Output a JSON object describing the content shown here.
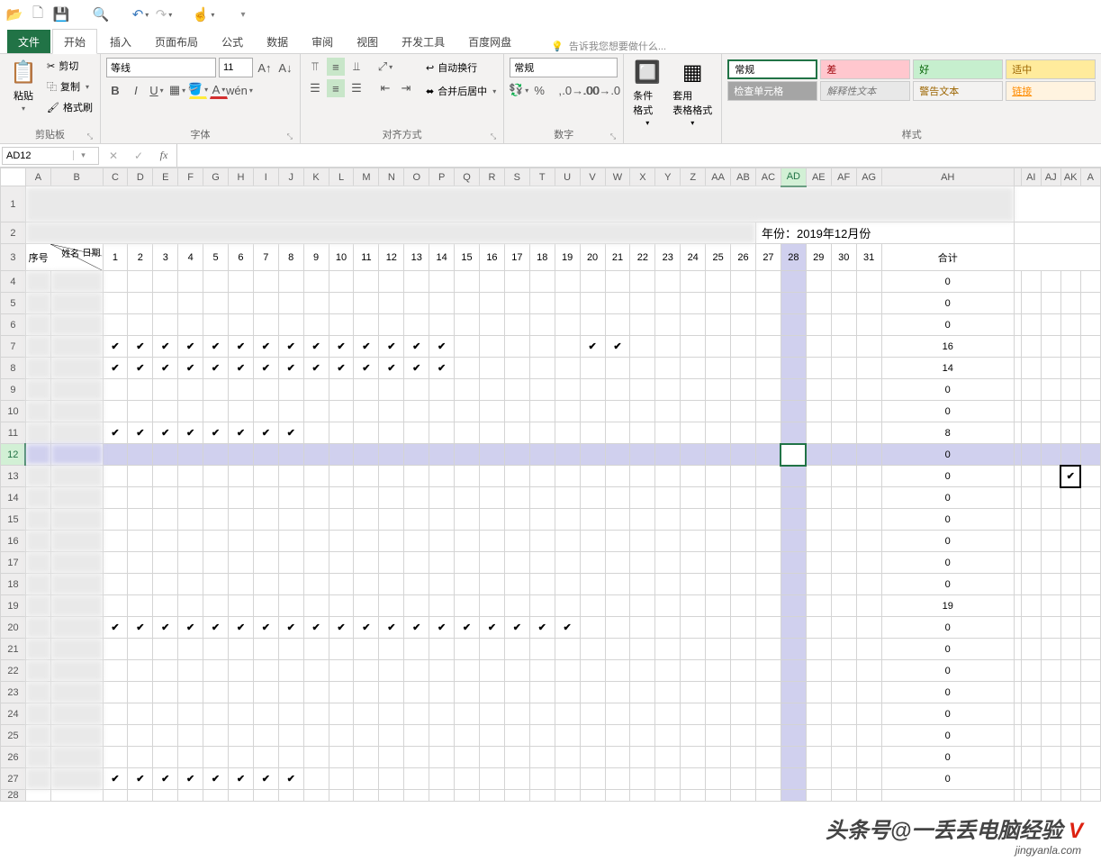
{
  "qat_icons": [
    "folder-open",
    "new-file",
    "save",
    "separator",
    "page-view",
    "separator",
    "undo",
    "redo",
    "separator",
    "touch-mode",
    "separator",
    "dropdown"
  ],
  "tabs": {
    "file": "文件",
    "home": "开始",
    "insert": "插入",
    "layout": "页面布局",
    "formulas": "公式",
    "data": "数据",
    "review": "审阅",
    "view": "视图",
    "dev": "开发工具",
    "baidu": "百度网盘",
    "tellme": "告诉我您想要做什么..."
  },
  "ribbon": {
    "clipboard": {
      "paste": "粘贴",
      "cut": "剪切",
      "copy": "复制",
      "painter": "格式刷",
      "label": "剪贴板"
    },
    "font": {
      "name": "等线",
      "size": "11",
      "label": "字体"
    },
    "align": {
      "wrap": "自动换行",
      "merge": "合并后居中",
      "label": "对齐方式"
    },
    "number": {
      "format": "常规",
      "label": "数字"
    },
    "styles": {
      "cond": "条件格式",
      "table": "套用\n表格格式",
      "normal": "常规",
      "check": "检查单元格",
      "explain": "解释性文本",
      "bad": "差",
      "good": "好",
      "warn": "警告文本",
      "fit": "适中",
      "link": "链接",
      "label": "样式"
    }
  },
  "name_box": "AD12",
  "columns": [
    "A",
    "B",
    "C",
    "D",
    "E",
    "F",
    "G",
    "H",
    "I",
    "J",
    "K",
    "L",
    "M",
    "N",
    "O",
    "P",
    "Q",
    "R",
    "S",
    "T",
    "U",
    "V",
    "W",
    "X",
    "Y",
    "Z",
    "AA",
    "AB",
    "AC",
    "AD",
    "AE",
    "AF",
    "AG",
    "AH",
    "",
    "AI",
    "AJ",
    "AK",
    "A"
  ],
  "row2_year": "年份：2019年12月份",
  "header3": {
    "seq": "序号",
    "name": "姓名",
    "date": "日期",
    "total": "合计"
  },
  "days": [
    "1",
    "2",
    "3",
    "4",
    "5",
    "6",
    "7",
    "8",
    "9",
    "10",
    "11",
    "12",
    "13",
    "14",
    "15",
    "16",
    "17",
    "18",
    "19",
    "20",
    "21",
    "22",
    "23",
    "24",
    "25",
    "26",
    "27",
    "28",
    "29",
    "30",
    "31"
  ],
  "totals": [
    "0",
    "0",
    "0",
    "16",
    "14",
    "0",
    "0",
    "8",
    "0",
    "0",
    "0",
    "0",
    "0",
    "0",
    "0",
    "19",
    "0",
    "0",
    "0",
    "0",
    "0",
    "0",
    "0",
    "0"
  ],
  "check_rows": {
    "7": [
      1,
      2,
      3,
      4,
      5,
      6,
      7,
      8,
      9,
      10,
      11,
      12,
      13,
      14,
      20,
      21
    ],
    "8": [
      1,
      2,
      3,
      4,
      5,
      6,
      7,
      8,
      9,
      10,
      11,
      12,
      13,
      14
    ],
    "11": [
      1,
      2,
      3,
      4,
      5,
      6,
      7,
      8
    ],
    "20": [
      1,
      2,
      3,
      4,
      5,
      6,
      7,
      8,
      9,
      10,
      11,
      12,
      13,
      14,
      15,
      16,
      17,
      18,
      19
    ],
    "27": [
      1,
      2,
      3,
      4,
      5,
      6,
      7,
      8
    ]
  },
  "stray_check": {
    "row": 13,
    "col_rel": "AK"
  },
  "active_cell": {
    "row": 12,
    "col": "AD"
  },
  "watermark": {
    "main": "头条号@一丢丢电脑经验",
    "v": "V",
    "sub": "jingyanla.com"
  }
}
